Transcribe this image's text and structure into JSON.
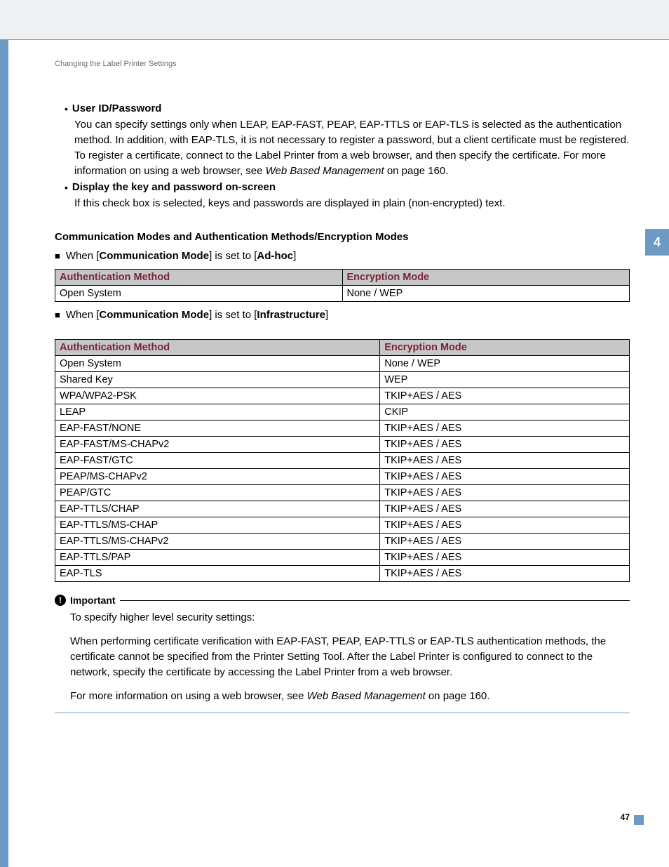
{
  "breadcrumb": "Changing the Label Printer Settings",
  "chapter_tab": "4",
  "page_number": "47",
  "bullets": {
    "b1": {
      "title": "User ID/Password",
      "body_pre": "You can specify settings only when LEAP, EAP-FAST, PEAP, EAP-TTLS or EAP-TLS is selected as the authentication method. In addition, with EAP-TLS, it is not necessary to register a password, but a client certificate must be registered. To register a certificate, connect to the Label Printer from a web browser, and then specify the certificate. For more information on using a web browser, see ",
      "body_italic": "Web Based Management",
      "body_post": " on page 160."
    },
    "b2": {
      "title": "Display the key and password on-screen",
      "body": "If this check box is selected, keys and passwords are displayed in plain (non-encrypted) text."
    }
  },
  "section_title": "Communication Modes and Authentication Methods/Encryption Modes",
  "square1": {
    "pre": "When [",
    "b1": "Communication Mode",
    "mid": "] is set to [",
    "b2": "Ad-hoc",
    "post": "]"
  },
  "square2": {
    "pre": "When [",
    "b1": "Communication Mode",
    "mid": "] is set to [",
    "b2": "Infrastructure",
    "post": "]"
  },
  "th": {
    "auth": "Authentication Method",
    "enc": "Encryption Mode"
  },
  "table1": {
    "r0": {
      "a": "Open System",
      "e": "None / WEP"
    }
  },
  "table2": {
    "r0": {
      "a": "Open System",
      "e": "None / WEP"
    },
    "r1": {
      "a": "Shared Key",
      "e": "WEP"
    },
    "r2": {
      "a": "WPA/WPA2-PSK",
      "e": "TKIP+AES / AES"
    },
    "r3": {
      "a": "LEAP",
      "e": "CKIP"
    },
    "r4": {
      "a": "EAP-FAST/NONE",
      "e": "TKIP+AES / AES"
    },
    "r5": {
      "a": "EAP-FAST/MS-CHAPv2",
      "e": "TKIP+AES / AES"
    },
    "r6": {
      "a": "EAP-FAST/GTC",
      "e": "TKIP+AES / AES"
    },
    "r7": {
      "a": "PEAP/MS-CHAPv2",
      "e": "TKIP+AES / AES"
    },
    "r8": {
      "a": "PEAP/GTC",
      "e": "TKIP+AES / AES"
    },
    "r9": {
      "a": "EAP-TTLS/CHAP",
      "e": "TKIP+AES / AES"
    },
    "r10": {
      "a": "EAP-TTLS/MS-CHAP",
      "e": "TKIP+AES / AES"
    },
    "r11": {
      "a": "EAP-TTLS/MS-CHAPv2",
      "e": "TKIP+AES / AES"
    },
    "r12": {
      "a": "EAP-TTLS/PAP",
      "e": "TKIP+AES / AES"
    },
    "r13": {
      "a": "EAP-TLS",
      "e": "TKIP+AES / AES"
    }
  },
  "important": {
    "label": "Important",
    "p1": "To specify higher level security settings:",
    "p2": "When performing certificate verification with EAP-FAST, PEAP, EAP-TTLS or EAP-TLS authentication methods, the certificate cannot be specified from the Printer Setting Tool. After the Label Printer is configured to connect to the network, specify the certificate by accessing the Label Printer from a web browser.",
    "p3_pre": "For more information on using a web browser, see ",
    "p3_italic": "Web Based Management",
    "p3_post": " on page 160."
  }
}
